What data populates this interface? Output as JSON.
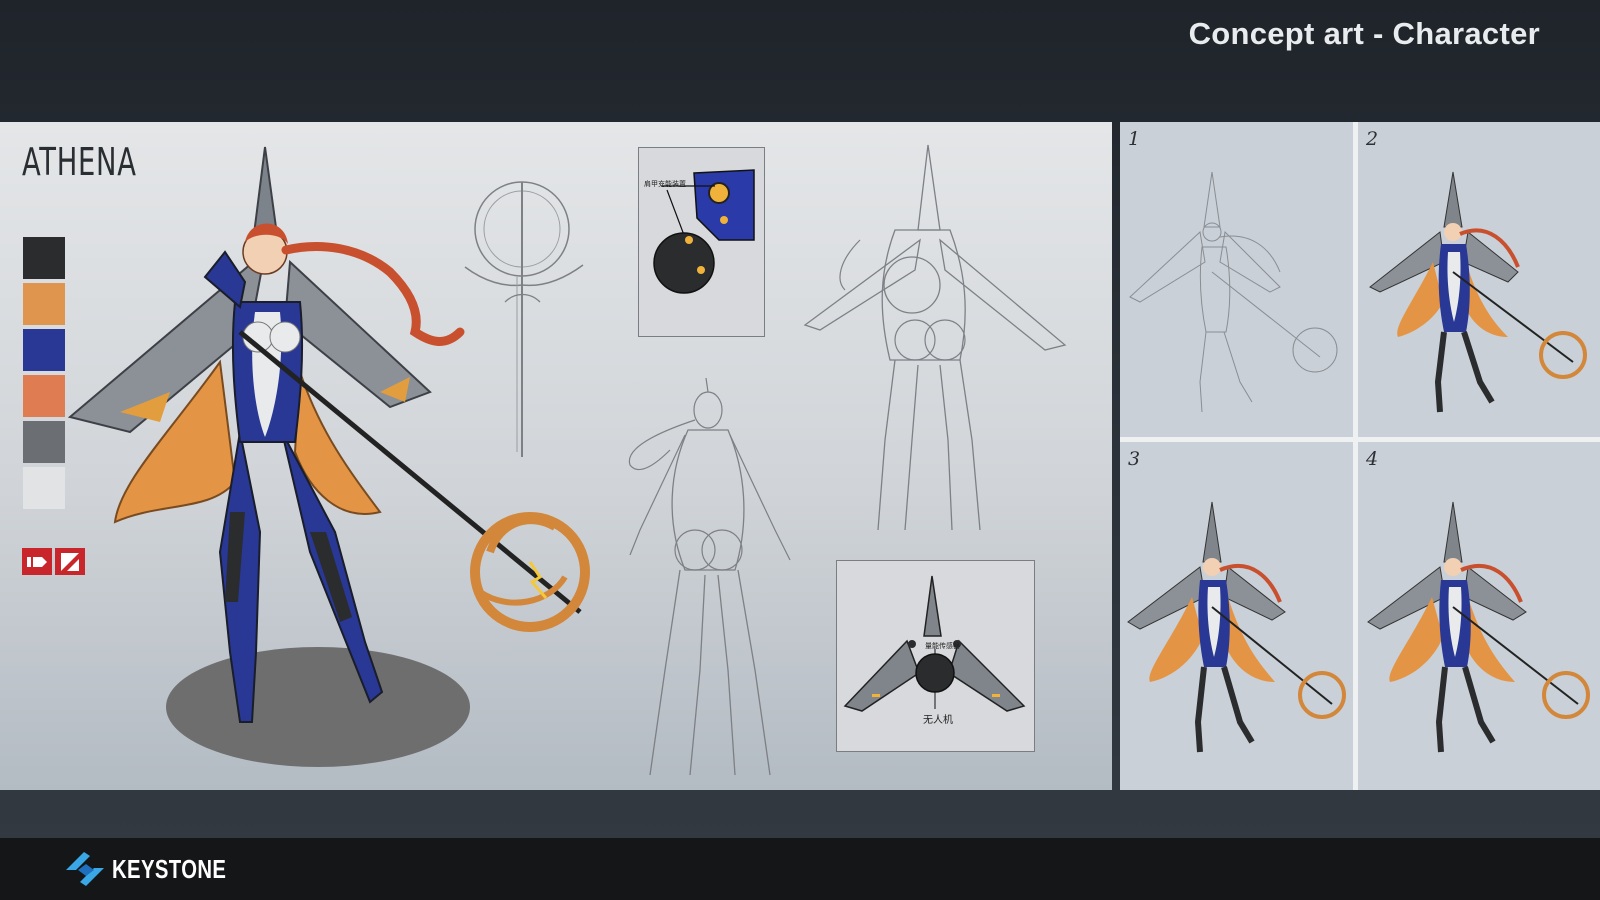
{
  "header": {
    "title": "Concept art - Character"
  },
  "sheet": {
    "character_name": "ATHENA",
    "palette": [
      "#2b2c2e",
      "#e0954f",
      "#283894",
      "#e07c52",
      "#6b6e72",
      "#e1e3e5"
    ],
    "badges": [
      {
        "icon": "video-tag-icon",
        "color": "#c8262b"
      },
      {
        "icon": "slash-tag-icon",
        "color": "#c8262b"
      }
    ],
    "accent_colors": {
      "suit_blue": "#2a3aa8",
      "cape_orange": "#e0974a",
      "hair_red": "#c9502e",
      "armor_grey": "#7f858b"
    },
    "callouts": {
      "shoulder_note": "肩甲充能装置",
      "drone_top_note": "量能传感器",
      "drone_bottom_note": "无人机"
    }
  },
  "stages": [
    {
      "number": "1",
      "style": "line-sketch"
    },
    {
      "number": "2",
      "style": "color"
    },
    {
      "number": "3",
      "style": "color"
    },
    {
      "number": "4",
      "style": "color"
    }
  ],
  "footer": {
    "brand": "KEYSTONE",
    "logo_icon": "keystone-logo-icon"
  }
}
